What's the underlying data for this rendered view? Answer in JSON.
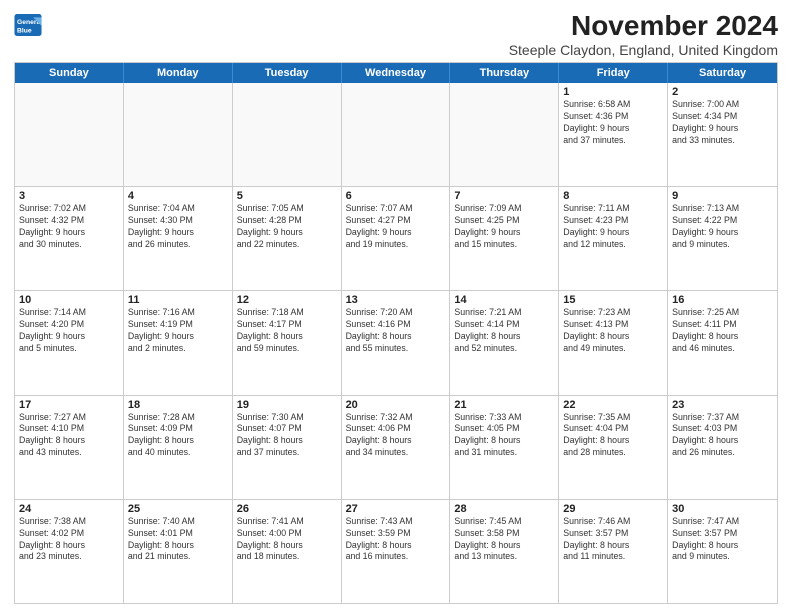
{
  "logo": {
    "line1": "General",
    "line2": "Blue"
  },
  "title": "November 2024",
  "subtitle": "Steeple Claydon, England, United Kingdom",
  "weekdays": [
    "Sunday",
    "Monday",
    "Tuesday",
    "Wednesday",
    "Thursday",
    "Friday",
    "Saturday"
  ],
  "rows": [
    [
      {
        "day": "",
        "info": ""
      },
      {
        "day": "",
        "info": ""
      },
      {
        "day": "",
        "info": ""
      },
      {
        "day": "",
        "info": ""
      },
      {
        "day": "",
        "info": ""
      },
      {
        "day": "1",
        "info": "Sunrise: 6:58 AM\nSunset: 4:36 PM\nDaylight: 9 hours\nand 37 minutes."
      },
      {
        "day": "2",
        "info": "Sunrise: 7:00 AM\nSunset: 4:34 PM\nDaylight: 9 hours\nand 33 minutes."
      }
    ],
    [
      {
        "day": "3",
        "info": "Sunrise: 7:02 AM\nSunset: 4:32 PM\nDaylight: 9 hours\nand 30 minutes."
      },
      {
        "day": "4",
        "info": "Sunrise: 7:04 AM\nSunset: 4:30 PM\nDaylight: 9 hours\nand 26 minutes."
      },
      {
        "day": "5",
        "info": "Sunrise: 7:05 AM\nSunset: 4:28 PM\nDaylight: 9 hours\nand 22 minutes."
      },
      {
        "day": "6",
        "info": "Sunrise: 7:07 AM\nSunset: 4:27 PM\nDaylight: 9 hours\nand 19 minutes."
      },
      {
        "day": "7",
        "info": "Sunrise: 7:09 AM\nSunset: 4:25 PM\nDaylight: 9 hours\nand 15 minutes."
      },
      {
        "day": "8",
        "info": "Sunrise: 7:11 AM\nSunset: 4:23 PM\nDaylight: 9 hours\nand 12 minutes."
      },
      {
        "day": "9",
        "info": "Sunrise: 7:13 AM\nSunset: 4:22 PM\nDaylight: 9 hours\nand 9 minutes."
      }
    ],
    [
      {
        "day": "10",
        "info": "Sunrise: 7:14 AM\nSunset: 4:20 PM\nDaylight: 9 hours\nand 5 minutes."
      },
      {
        "day": "11",
        "info": "Sunrise: 7:16 AM\nSunset: 4:19 PM\nDaylight: 9 hours\nand 2 minutes."
      },
      {
        "day": "12",
        "info": "Sunrise: 7:18 AM\nSunset: 4:17 PM\nDaylight: 8 hours\nand 59 minutes."
      },
      {
        "day": "13",
        "info": "Sunrise: 7:20 AM\nSunset: 4:16 PM\nDaylight: 8 hours\nand 55 minutes."
      },
      {
        "day": "14",
        "info": "Sunrise: 7:21 AM\nSunset: 4:14 PM\nDaylight: 8 hours\nand 52 minutes."
      },
      {
        "day": "15",
        "info": "Sunrise: 7:23 AM\nSunset: 4:13 PM\nDaylight: 8 hours\nand 49 minutes."
      },
      {
        "day": "16",
        "info": "Sunrise: 7:25 AM\nSunset: 4:11 PM\nDaylight: 8 hours\nand 46 minutes."
      }
    ],
    [
      {
        "day": "17",
        "info": "Sunrise: 7:27 AM\nSunset: 4:10 PM\nDaylight: 8 hours\nand 43 minutes."
      },
      {
        "day": "18",
        "info": "Sunrise: 7:28 AM\nSunset: 4:09 PM\nDaylight: 8 hours\nand 40 minutes."
      },
      {
        "day": "19",
        "info": "Sunrise: 7:30 AM\nSunset: 4:07 PM\nDaylight: 8 hours\nand 37 minutes."
      },
      {
        "day": "20",
        "info": "Sunrise: 7:32 AM\nSunset: 4:06 PM\nDaylight: 8 hours\nand 34 minutes."
      },
      {
        "day": "21",
        "info": "Sunrise: 7:33 AM\nSunset: 4:05 PM\nDaylight: 8 hours\nand 31 minutes."
      },
      {
        "day": "22",
        "info": "Sunrise: 7:35 AM\nSunset: 4:04 PM\nDaylight: 8 hours\nand 28 minutes."
      },
      {
        "day": "23",
        "info": "Sunrise: 7:37 AM\nSunset: 4:03 PM\nDaylight: 8 hours\nand 26 minutes."
      }
    ],
    [
      {
        "day": "24",
        "info": "Sunrise: 7:38 AM\nSunset: 4:02 PM\nDaylight: 8 hours\nand 23 minutes."
      },
      {
        "day": "25",
        "info": "Sunrise: 7:40 AM\nSunset: 4:01 PM\nDaylight: 8 hours\nand 21 minutes."
      },
      {
        "day": "26",
        "info": "Sunrise: 7:41 AM\nSunset: 4:00 PM\nDaylight: 8 hours\nand 18 minutes."
      },
      {
        "day": "27",
        "info": "Sunrise: 7:43 AM\nSunset: 3:59 PM\nDaylight: 8 hours\nand 16 minutes."
      },
      {
        "day": "28",
        "info": "Sunrise: 7:45 AM\nSunset: 3:58 PM\nDaylight: 8 hours\nand 13 minutes."
      },
      {
        "day": "29",
        "info": "Sunrise: 7:46 AM\nSunset: 3:57 PM\nDaylight: 8 hours\nand 11 minutes."
      },
      {
        "day": "30",
        "info": "Sunrise: 7:47 AM\nSunset: 3:57 PM\nDaylight: 8 hours\nand 9 minutes."
      }
    ]
  ]
}
